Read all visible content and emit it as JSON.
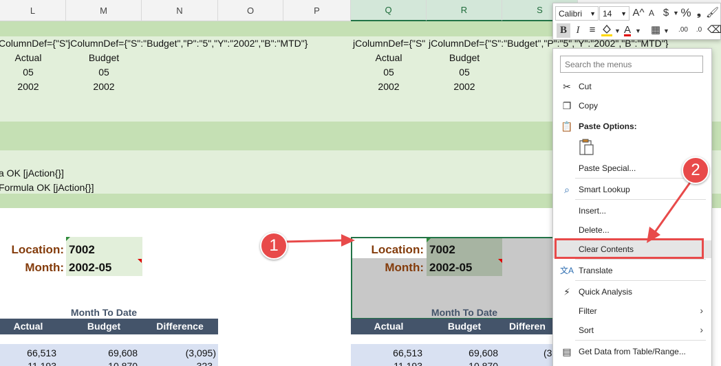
{
  "columns": [
    "L",
    "M",
    "N",
    "O",
    "P",
    "Q",
    "R",
    "S"
  ],
  "formulas": {
    "left_1": "ColumnDef={\"S\"",
    "left_2": "jColumnDef={\"S\":\"Budget\",\"P\":\"5\",\"Y\":\"2002\",\"B\":\"MTD\"}",
    "right_1": "jColumnDef={\"S\"",
    "right_2": "jColumnDef={\"S\":\"Budget\",\"P\":\"5\",\"Y\":\"2002\",\"B\":\"MTD\"}"
  },
  "def_rows": {
    "actual": "Actual",
    "budget": "Budget",
    "period": "05",
    "year": "2002"
  },
  "status_lines": [
    "a OK [jAction{}]",
    "Formula OK [jAction{}]"
  ],
  "params": {
    "location_label": "Location:",
    "location_value": "7002",
    "month_label": "Month:",
    "month_value": "2002-05"
  },
  "report": {
    "title": "Month To Date",
    "headers": [
      "Actual",
      "Budget",
      "Difference"
    ],
    "right_headers": [
      "Actual",
      "Budget",
      "Differen"
    ],
    "rows": [
      [
        "66,513",
        "69,608",
        "(3,095)"
      ],
      [
        "11,193",
        "10,870",
        "323"
      ]
    ],
    "right_rows": [
      [
        "66,513",
        "69,608",
        "(3"
      ],
      [
        "11,193",
        "10,870",
        ""
      ]
    ]
  },
  "mini_toolbar": {
    "font": "Calibri",
    "size": "14",
    "grow": "A^",
    "shrink": "A",
    "currency": "$",
    "percent": "%",
    "comma": "❟",
    "bold": "B",
    "italic": "I",
    "font_color": "A",
    "inc_decimal": ".00",
    "dec_decimal": ".0"
  },
  "menu": {
    "search_placeholder": "Search the menus",
    "cut": "Cut",
    "copy": "Copy",
    "paste_options": "Paste Options:",
    "paste_special": "Paste Special...",
    "smart_lookup": "Smart Lookup",
    "insert": "Insert...",
    "delete": "Delete...",
    "clear_contents": "Clear Contents",
    "translate": "Translate",
    "quick_analysis": "Quick Analysis",
    "filter": "Filter",
    "sort": "Sort",
    "get_data": "Get Data from Table/Range..."
  },
  "callouts": {
    "one": "1",
    "two": "2"
  },
  "colors": {
    "band_dark": "#c5e0b4",
    "band_light": "#e2efda",
    "label_brown": "#843c0c",
    "header_slate": "#44546a",
    "row_blue": "#d9e1f2",
    "selection_gray": "#c8c8c8",
    "callout_red": "#e84a4a"
  }
}
